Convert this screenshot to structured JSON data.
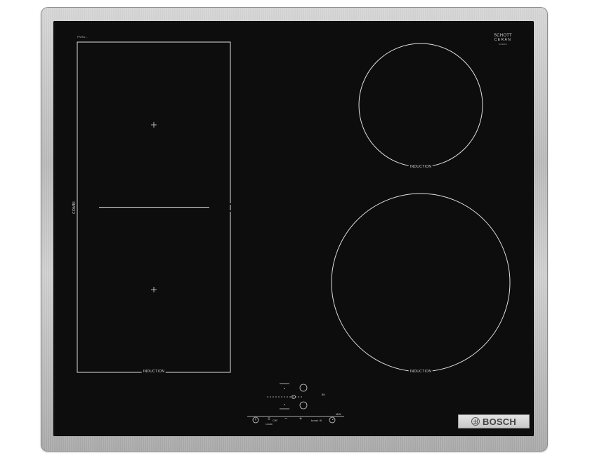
{
  "hob": {
    "model_number": "PVS6...",
    "brand": "BOSCH",
    "brand_logo": "bosch-armature-logo",
    "glass_badge": {
      "line1": "SCHOTT",
      "line2": "CERAN",
      "line3": "CERAN"
    },
    "zones": {
      "combi_label": "COMBI",
      "flex_label": "INDUCTION",
      "top_right_label": "INDUCTION",
      "bottom_right_label": "INDUCTION"
    },
    "controls": {
      "combi_symbol": "≡",
      "combi_text": "CIR",
      "boost_text": "boost",
      "boost_suffix": "fil",
      "small_label": "COMBI",
      "top_small": "MIN",
      "side_digit": "88",
      "minus": "−",
      "plus": "+",
      "power_icon": "power-icon",
      "timer_icon": "timer-icon"
    }
  },
  "colors": {
    "glass": "#0d0d0d",
    "frame": "#c0c0c0",
    "lines": "#e0e0e0"
  }
}
